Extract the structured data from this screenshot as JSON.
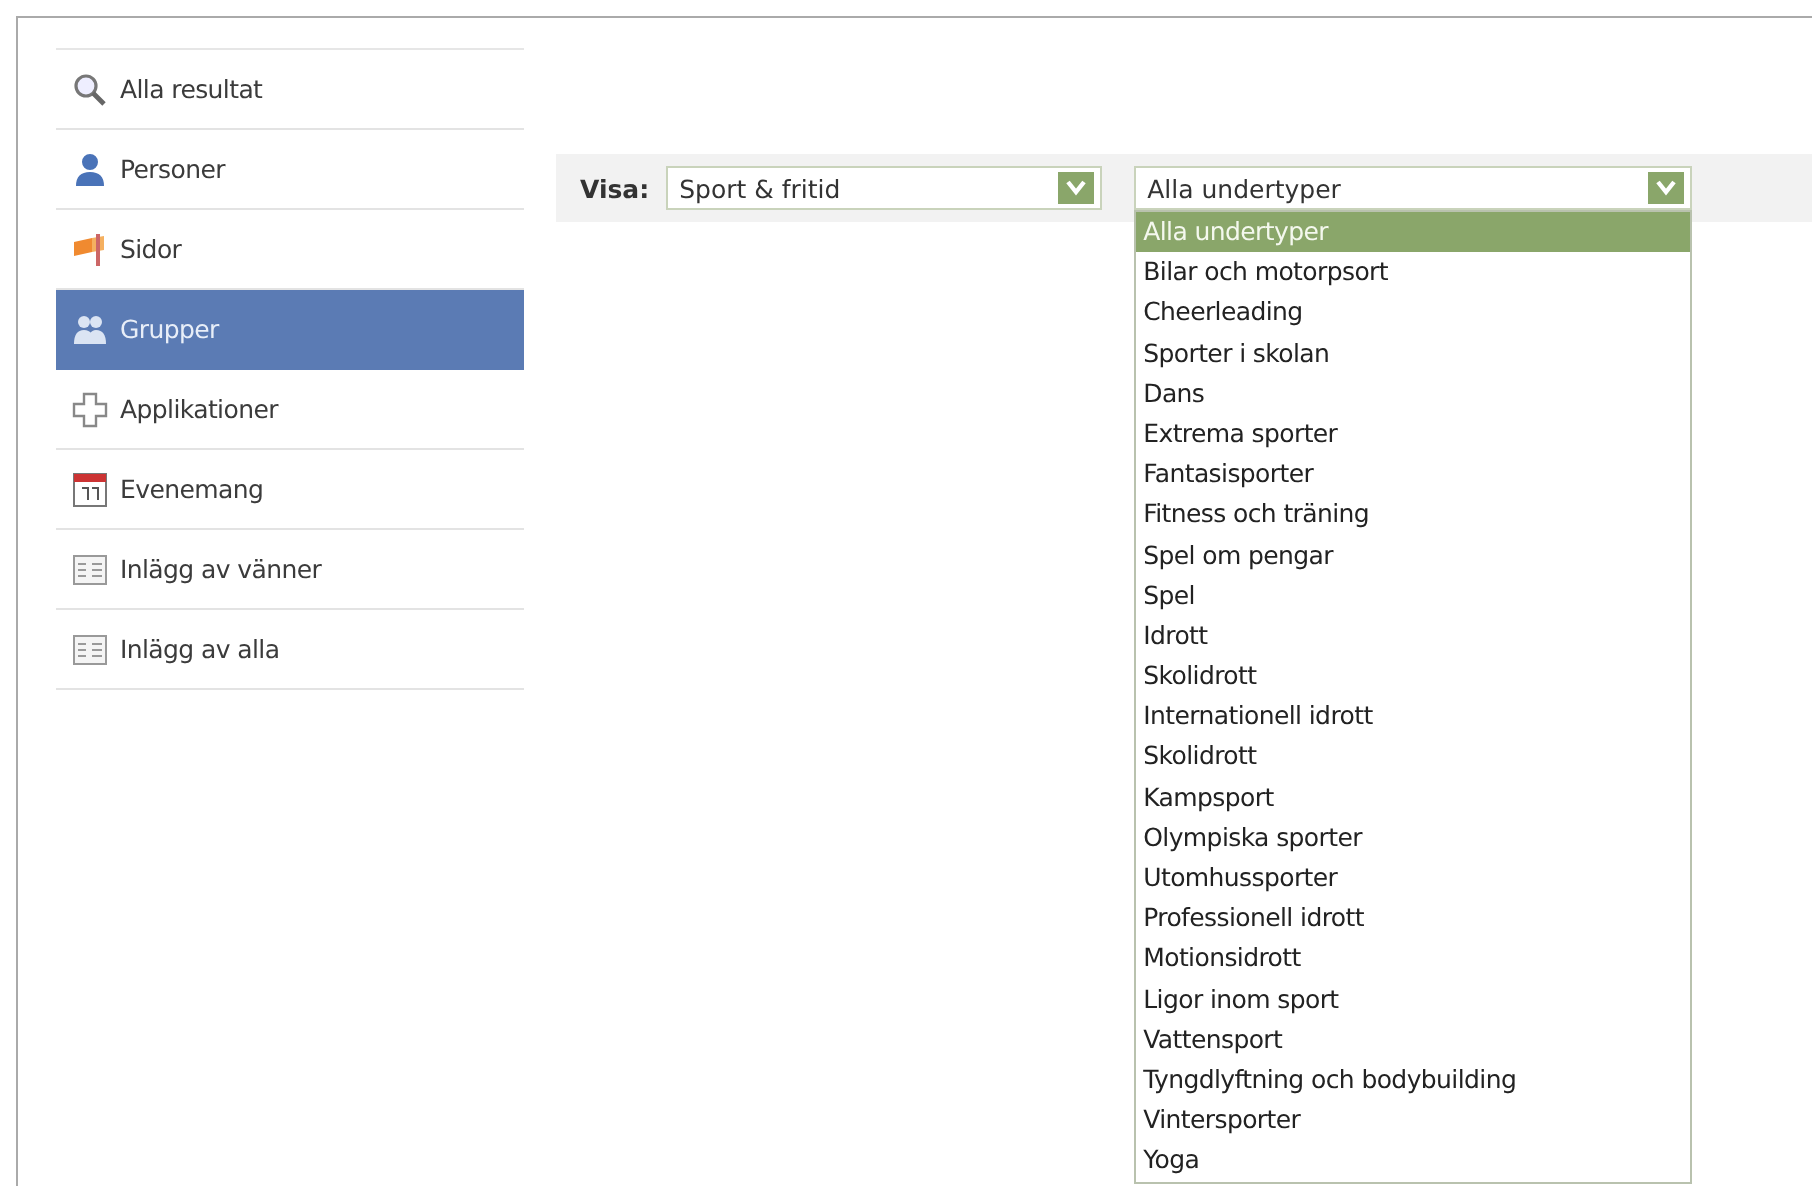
{
  "sidebar": {
    "items": [
      {
        "kind": "search",
        "label": "Alla resultat",
        "selected": false
      },
      {
        "kind": "person",
        "label": "Personer",
        "selected": false
      },
      {
        "kind": "flag",
        "label": "Sidor",
        "selected": false
      },
      {
        "kind": "group",
        "label": "Grupper",
        "selected": true
      },
      {
        "kind": "puzzle",
        "label": "Applikationer",
        "selected": false
      },
      {
        "kind": "calendar",
        "label": "Evenemang",
        "selected": false
      },
      {
        "kind": "post",
        "label": "Inlägg av vänner",
        "selected": false
      },
      {
        "kind": "post",
        "label": "Inlägg av alla",
        "selected": false
      }
    ]
  },
  "filter": {
    "label": "Visa:",
    "category": {
      "value": "Sport & fritid"
    },
    "subtype": {
      "value": "Alla undertyper",
      "expanded": true,
      "options": [
        {
          "label": "Alla undertyper",
          "selected": true
        },
        {
          "label": "Bilar och motorpsort",
          "selected": false
        },
        {
          "label": "Cheerleading",
          "selected": false
        },
        {
          "label": "Sporter i skolan",
          "selected": false
        },
        {
          "label": "Dans",
          "selected": false
        },
        {
          "label": "Extrema sporter",
          "selected": false
        },
        {
          "label": "Fantasisporter",
          "selected": false
        },
        {
          "label": "Fitness och träning",
          "selected": false
        },
        {
          "label": "Spel om pengar",
          "selected": false
        },
        {
          "label": "Spel",
          "selected": false
        },
        {
          "label": "Idrott",
          "selected": false
        },
        {
          "label": "Skolidrott",
          "selected": false
        },
        {
          "label": "Internationell idrott",
          "selected": false
        },
        {
          "label": "Skolidrott",
          "selected": false
        },
        {
          "label": "Kampsport",
          "selected": false
        },
        {
          "label": "Olympiska sporter",
          "selected": false
        },
        {
          "label": "Utomhussporter",
          "selected": false
        },
        {
          "label": "Professionell idrott",
          "selected": false
        },
        {
          "label": "Motionsidrott",
          "selected": false
        },
        {
          "label": "Ligor inom sport",
          "selected": false
        },
        {
          "label": "Vattensport",
          "selected": false
        },
        {
          "label": "Tyngdlyftning och bodybuilding",
          "selected": false
        },
        {
          "label": "Vintersporter",
          "selected": false
        },
        {
          "label": "Yoga",
          "selected": false
        }
      ]
    }
  }
}
